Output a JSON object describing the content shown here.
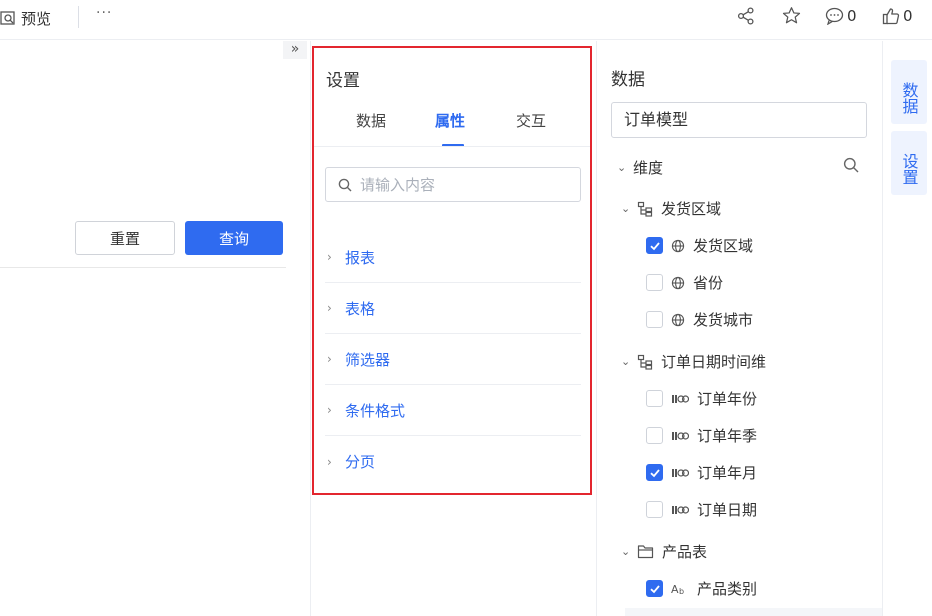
{
  "topbar": {
    "preview_label": "预览",
    "more_label": "···",
    "comment_count": "0",
    "like_count": "0"
  },
  "canvas": {
    "collapse_label": "»",
    "reset_label": "重置",
    "query_label": "查询"
  },
  "settings": {
    "title": "设置",
    "tabs": [
      {
        "label": "数据"
      },
      {
        "label": "属性"
      },
      {
        "label": "交互"
      }
    ],
    "active_tab": "属性",
    "search_placeholder": "请输入内容",
    "items": [
      {
        "label": "报表"
      },
      {
        "label": "表格"
      },
      {
        "label": "筛选器"
      },
      {
        "label": "条件格式"
      },
      {
        "label": "分页"
      }
    ]
  },
  "data_panel": {
    "title": "数据",
    "model": "订单模型",
    "dimension_label": "维度",
    "tree": [
      {
        "label": "发货区域",
        "type": "group",
        "icon": "hierarchy-icon"
      },
      {
        "label": "发货区域",
        "type": "field",
        "icon": "globe-icon",
        "checked": true
      },
      {
        "label": "省份",
        "type": "field",
        "icon": "globe-icon",
        "checked": false
      },
      {
        "label": "发货城市",
        "type": "field",
        "icon": "globe-icon",
        "checked": false
      },
      {
        "label": "订单日期时间维",
        "type": "group",
        "icon": "hierarchy-icon"
      },
      {
        "label": "订单年份",
        "type": "field",
        "icon": "date-icon",
        "checked": false
      },
      {
        "label": "订单年季",
        "type": "field",
        "icon": "date-icon",
        "checked": false
      },
      {
        "label": "订单年月",
        "type": "field",
        "icon": "date-icon",
        "checked": true
      },
      {
        "label": "订单日期",
        "type": "field",
        "icon": "date-icon",
        "checked": false
      },
      {
        "label": "产品表",
        "type": "group",
        "icon": "folder-icon"
      },
      {
        "label": "产品类别",
        "type": "field",
        "icon": "text-type-icon",
        "checked": true
      }
    ]
  },
  "side_tabs": [
    {
      "label": "数据"
    },
    {
      "label": "设置"
    }
  ],
  "colors": {
    "accent": "#2f6bf0",
    "highlight_border": "#e3262f"
  }
}
